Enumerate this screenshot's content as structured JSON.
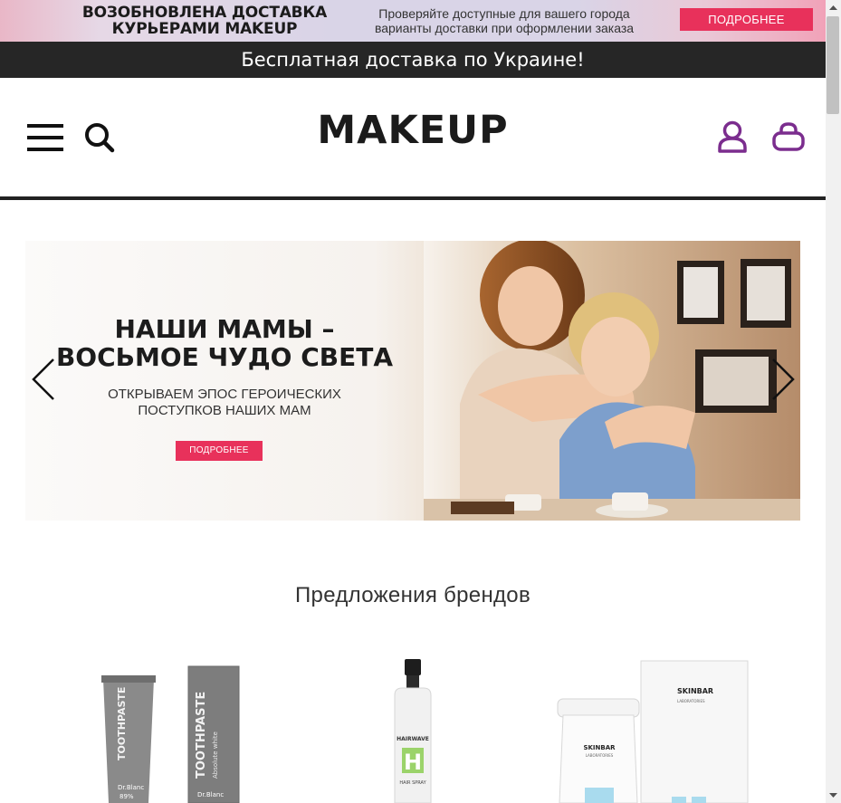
{
  "promo": {
    "title": "ВОЗОБНОВЛЕНА ДОСТАВКА КУРЬЕРАМИ MAKEUP",
    "text": "Проверяйте доступные для вашего города варианты доставки при оформлении заказа",
    "button": "ПОДРОБНЕЕ"
  },
  "free_shipping": "Бесплатная доставка по Украине!",
  "header": {
    "logo": "MAKEUP",
    "icons": [
      "menu-icon",
      "search-icon",
      "account-icon",
      "cart-icon"
    ]
  },
  "hero": {
    "title": "НАШИ МАМЫ – ВОСЬМОЕ ЧУДО СВЕТА",
    "subtitle": "ОТКРЫВАЕМ ЭПОС ГЕРОИЧЕСКИХ ПОСТУПКОВ НАШИХ МАМ",
    "button": "ПОДРОБНЕЕ",
    "prev_icon": "chevron-left-icon",
    "next_icon": "chevron-right-icon"
  },
  "brands": {
    "title": "Предложения брендов",
    "cards": [
      {
        "name": "Dr.Blanc",
        "product_label": "TOOTHPASTE",
        "variant": "Absolute white",
        "badge": "89%"
      },
      {
        "name": "HAIRWAVE",
        "product_label": "HAIR SPRAY",
        "letter": "H"
      },
      {
        "name": "SKINBAR",
        "product_label": "LABORATORIES"
      }
    ]
  },
  "colors": {
    "accent": "#e8315b",
    "icon_purple": "#7b2d8e",
    "dark": "#262626"
  }
}
